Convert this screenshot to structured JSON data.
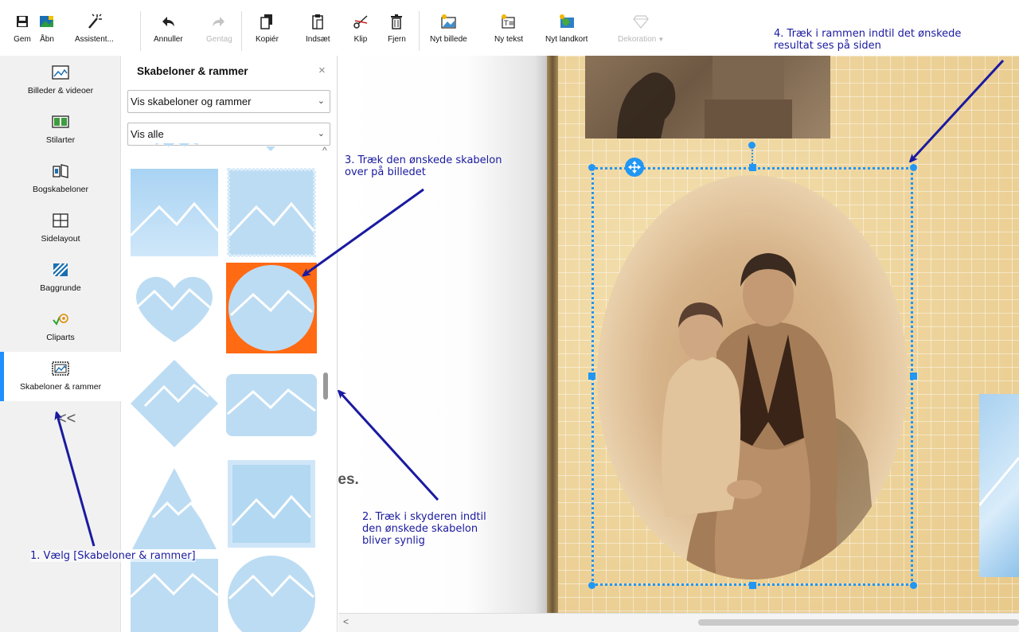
{
  "toolbar": {
    "save": "Gem",
    "open": "Åbn",
    "wizard": "Assistent...",
    "undo": "Annuller",
    "redo": "Gentag",
    "copy": "Kopiér",
    "paste": "Indsæt",
    "cut": "Klip",
    "remove": "Fjern",
    "new_image": "Nyt billede",
    "new_text": "Ny tekst",
    "new_map": "Nyt landkort",
    "decoration": "Dekoration"
  },
  "sidebar": {
    "items": [
      {
        "label": "Billeder & videoer"
      },
      {
        "label": "Stilarter"
      },
      {
        "label": "Bogskabeloner"
      },
      {
        "label": "Sidelayout"
      },
      {
        "label": "Baggrunde"
      },
      {
        "label": "Cliparts"
      },
      {
        "label": "Skabeloner & rammer"
      }
    ],
    "active_index": 6,
    "collapse": "<<"
  },
  "panel": {
    "title": "Skabeloner & rammer",
    "close": "×",
    "filter1": "Vis skabeloner og rammer",
    "filter2": "Vis alle",
    "chevron": "⌄"
  },
  "canvas": {
    "left_page_text": "res.",
    "left_arrow": "<"
  },
  "annotations": {
    "step1": "1. Vælg [Skabeloner & rammer]",
    "step2_l1": "2. Træk i skyderen indtil",
    "step2_l2": "den ønskede skabelon",
    "step2_l3": "bliver synlig",
    "step3_l1": "3. Træk den ønskede skabelon",
    "step3_l2": "over på billedet",
    "step4_l1": "4. Træk i rammen indtil det ønskede",
    "step4_l2": "resultat ses på siden"
  },
  "colors": {
    "accent": "#2196f3",
    "annotation": "#1a1aa0",
    "selected_template": "#ff6a13",
    "template_blue": "#b9dcf5"
  }
}
